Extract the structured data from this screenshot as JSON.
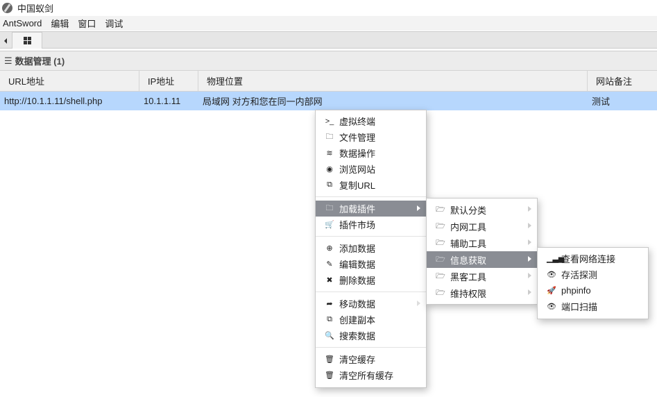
{
  "window": {
    "title": "中国蚁剑"
  },
  "menubar": [
    "AntSword",
    "编辑",
    "窗口",
    "调试"
  ],
  "panel": {
    "title": "数据管理 (1)"
  },
  "table": {
    "headers": [
      "URL地址",
      "IP地址",
      "物理位置",
      "网站备注"
    ],
    "rows": [
      {
        "url": "http://10.1.1.11/shell.php",
        "ip": "10.1.1.11",
        "location": "局域网 对方和您在同一内部网",
        "note": "测试"
      }
    ]
  },
  "context_menu": {
    "items": [
      {
        "label": "虚拟终端",
        "icon": "terminal-icon"
      },
      {
        "label": "文件管理",
        "icon": "folder-icon"
      },
      {
        "label": "数据操作",
        "icon": "database-icon"
      },
      {
        "label": "浏览网站",
        "icon": "chrome-icon"
      },
      {
        "label": "复制URL",
        "icon": "copy-icon"
      },
      {
        "label": "加载插件",
        "icon": "folder-icon"
      },
      {
        "label": "插件市场",
        "icon": "cart-icon"
      },
      {
        "label": "添加数据",
        "icon": "plus-circle-icon"
      },
      {
        "label": "编辑数据",
        "icon": "edit-icon"
      },
      {
        "label": "删除数据",
        "icon": "times-icon"
      },
      {
        "label": "移动数据",
        "icon": "share-icon"
      },
      {
        "label": "创建副本",
        "icon": "copy-icon"
      },
      {
        "label": "搜索数据",
        "icon": "search-icon"
      },
      {
        "label": "清空缓存",
        "icon": "trash-outline-icon"
      },
      {
        "label": "清空所有缓存",
        "icon": "trash-icon"
      }
    ]
  },
  "plugin_menu": {
    "items": [
      "默认分类",
      "内网工具",
      "辅助工具",
      "信息获取",
      "黑客工具",
      "维持权限"
    ]
  },
  "info_menu": {
    "items": [
      "查看网络连接",
      "存活探测",
      "phpinfo",
      "端口扫描"
    ]
  }
}
